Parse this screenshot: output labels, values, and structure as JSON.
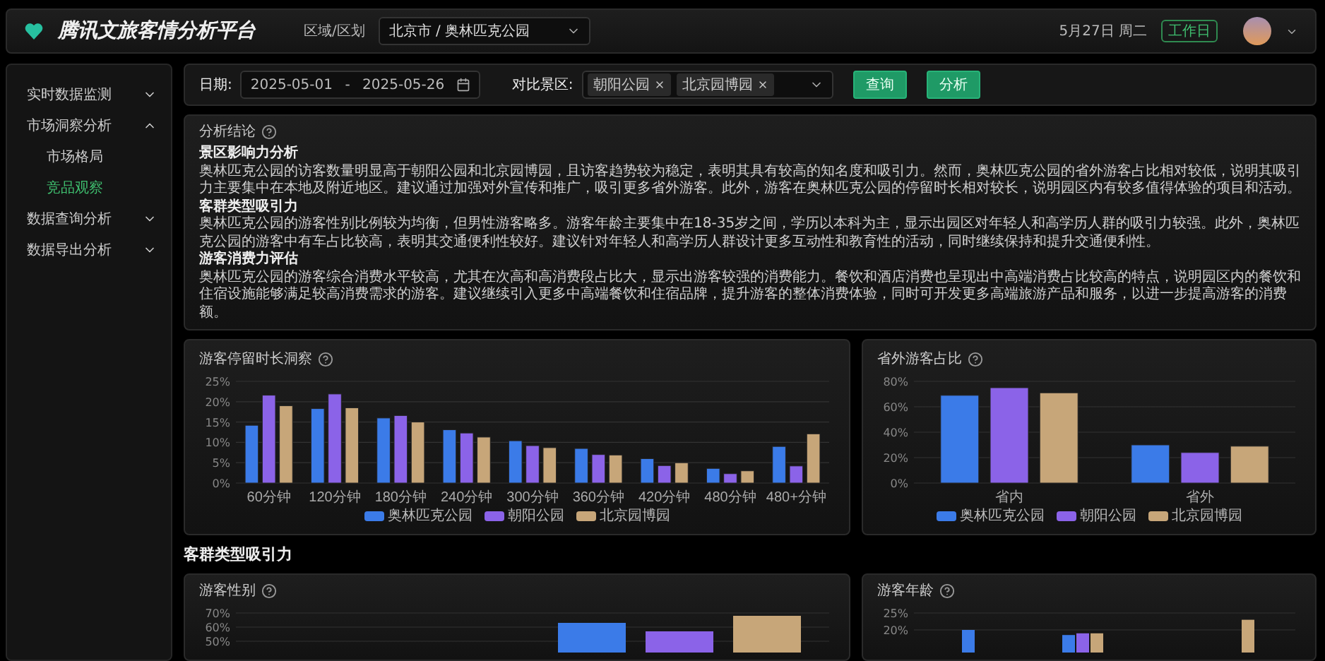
{
  "header": {
    "logo_text": "腾讯文旅客情分析平台",
    "region_label": "区域/区划",
    "region_value": "北京市 / 奥林匹克公园",
    "date": "5月27日 周二",
    "day_badge": "工作日"
  },
  "sidebar": {
    "items": [
      {
        "label": "实时数据监测",
        "expanded": false,
        "selected": false
      },
      {
        "label": "市场洞察分析",
        "expanded": true,
        "selected": false,
        "children": [
          {
            "label": "市场格局",
            "selected": false
          },
          {
            "label": "竞品观察",
            "selected": true
          }
        ]
      },
      {
        "label": "数据查询分析",
        "expanded": false,
        "selected": false
      },
      {
        "label": "数据导出分析",
        "expanded": false,
        "selected": false
      }
    ]
  },
  "filters": {
    "date_label": "日期:",
    "start": "2025-05-01",
    "separator": "-",
    "end": "2025-05-26",
    "compare_label": "对比景区:",
    "tags": [
      "朝阳公园",
      "北京园博园"
    ],
    "buttons": [
      "查询",
      "分析"
    ]
  },
  "analysis": {
    "title": "分析结论",
    "sections": [
      {
        "heading": "景区影响力分析",
        "text": "奥林匹克公园的访客数量明显高于朝阳公园和北京园博园，且访客趋势较为稳定，表明其具有较高的知名度和吸引力。然而，奥林匹克公园的省外游客占比相对较低，说明其吸引力主要集中在本地及附近地区。建议通过加强对外宣传和推广，吸引更多省外游客。此外，游客在奥林匹克公园的停留时长相对较长，说明园区内有较多值得体验的项目和活动。"
      },
      {
        "heading": "客群类型吸引力",
        "text": "奥林匹克公园的游客性别比例较为均衡，但男性游客略多。游客年龄主要集中在18-35岁之间，学历以本科为主，显示出园区对年轻人和高学历人群的吸引力较强。此外，奥林匹克公园的游客中有车占比较高，表明其交通便利性较好。建议针对年轻人和高学历人群设计更多互动性和教育性的活动，同时继续保持和提升交通便利性。"
      },
      {
        "heading": "游客消费力评估",
        "text": "奥林匹克公园的游客综合消费水平较高，尤其在次高和高消费段占比大，显示出游客较强的消费能力。餐饮和酒店消费也呈现出中高端消费占比较高的特点，说明园区内的餐饮和住宿设施能够满足较高消费需求的游客。建议继续引入更多中高端餐饮和住宿品牌，提升游客的整体消费体验，同时可开发更多高端旅游产品和服务，以进一步提高游客的消费额。"
      }
    ]
  },
  "charts": [
    {
      "title": "游客停留时长洞察",
      "chart_data": {
        "type": "bar",
        "grid": true,
        "categories": [
          "60分钟",
          "120分钟",
          "180分钟",
          "240分钟",
          "300分钟",
          "360分钟",
          "420分钟",
          "480分钟",
          "480+分钟"
        ],
        "ylim": [
          0,
          25
        ],
        "yticks": [
          {
            "value": 0,
            "label": "0%"
          },
          {
            "value": 5,
            "label": "5%"
          },
          {
            "value": 10,
            "label": "10%"
          },
          {
            "value": 15,
            "label": "15%"
          },
          {
            "value": 20,
            "label": "20%"
          },
          {
            "value": 25,
            "label": "25%"
          }
        ],
        "series": [
          {
            "name": "奥林匹克公园",
            "color": "#3b7be8",
            "values": [
              14.2,
              18.3,
              16.0,
              13.1,
              10.4,
              8.5,
              6.0,
              3.6,
              9.0
            ]
          },
          {
            "name": "朝阳公园",
            "color": "#8b63e8",
            "values": [
              21.6,
              21.9,
              16.6,
              12.3,
              9.2,
              7.0,
              4.3,
              2.3,
              4.2
            ]
          },
          {
            "name": "北京园博园",
            "color": "#c7a679",
            "values": [
              19.0,
              18.5,
              15.0,
              11.3,
              8.7,
              6.9,
              5.0,
              3.0,
              12.1
            ]
          }
        ]
      }
    },
    {
      "title": "省外游客占比",
      "chart_data": {
        "type": "bar",
        "grid": true,
        "categories": [
          "省内",
          "省外"
        ],
        "ylim": [
          0,
          80
        ],
        "yticks": [
          {
            "value": 0,
            "label": "0%"
          },
          {
            "value": 20,
            "label": "20%"
          },
          {
            "value": 40,
            "label": "40%"
          },
          {
            "value": 60,
            "label": "60%"
          },
          {
            "value": 80,
            "label": "80%"
          }
        ],
        "series": [
          {
            "name": "奥林匹克公园",
            "color": "#3b7be8",
            "values": [
              69,
              30
            ]
          },
          {
            "name": "朝阳公园",
            "color": "#8b63e8",
            "values": [
              75,
              24
            ]
          },
          {
            "name": "北京园博园",
            "color": "#c7a679",
            "values": [
              71,
              29
            ]
          }
        ]
      }
    }
  ],
  "section_heading": "客群类型吸引力",
  "more_charts": [
    {
      "title": "游客性别",
      "axis_labels": [
        "70%",
        "60%",
        "50%"
      ]
    },
    {
      "title": "游客年龄",
      "axis_labels": [
        "25%",
        "20%"
      ]
    }
  ]
}
